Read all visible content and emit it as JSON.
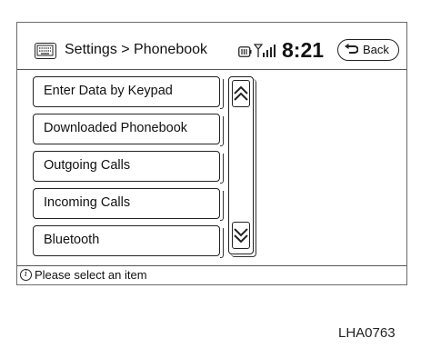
{
  "header": {
    "title": "Settings > Phonebook",
    "time": "8:21",
    "back_label": "Back",
    "menu_icon": "keypad-icon",
    "phone_icon": "phone-battery-icon",
    "signal_icon": "signal-strength-icon"
  },
  "menu": {
    "items": [
      {
        "label": "Enter Data by Keypad"
      },
      {
        "label": "Downloaded Phonebook"
      },
      {
        "label": "Outgoing Calls"
      },
      {
        "label": "Incoming Calls"
      },
      {
        "label": "Bluetooth"
      }
    ]
  },
  "scroll": {
    "up_icon": "double-chevron-up-icon",
    "down_icon": "double-chevron-down-icon"
  },
  "footer": {
    "icon": "info-icon",
    "message": "Please select an item"
  },
  "figure_code": "LHA0763"
}
